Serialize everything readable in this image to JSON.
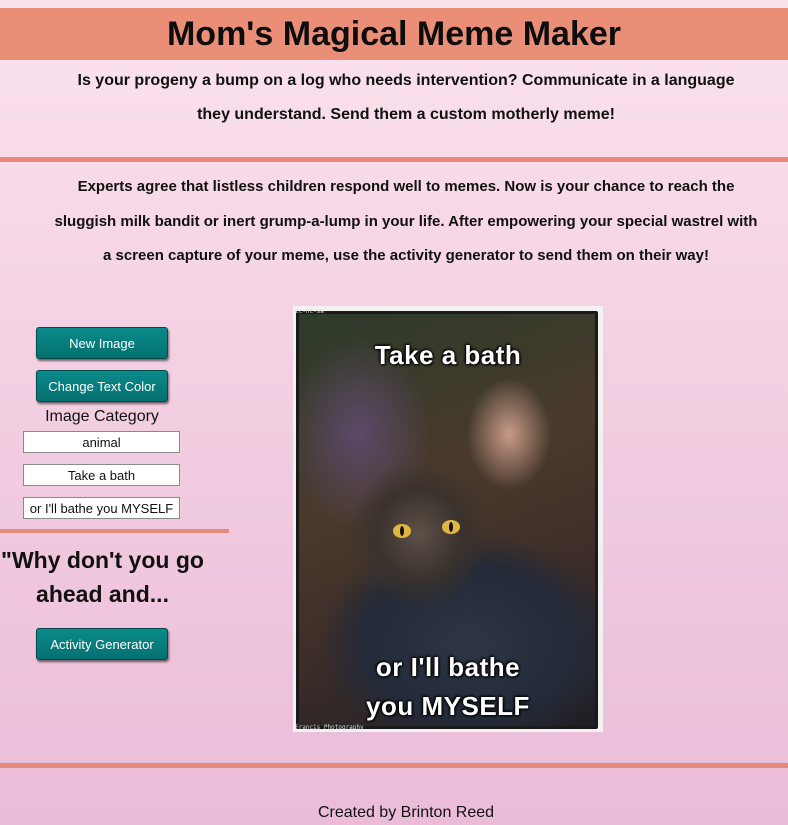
{
  "header": {
    "title": "Mom's Magical Meme Maker",
    "intro_line1": "Is your progeny a bump on a log who needs intervention? Communicate in a language",
    "intro_line2": "they understand. Send them a custom motherly meme!"
  },
  "description": {
    "line1": "Experts agree that listless children respond well to memes. Now is your chance to reach the",
    "line2": "sluggish milk bandit or inert grump-a-lump in your life. After empowering your special wastrel with",
    "line3": "a screen capture of your meme, use the activity generator to send them on their way!"
  },
  "controls": {
    "new_image_label": "New Image",
    "change_color_label": "Change Text Color",
    "category_label": "Image Category",
    "category_value": "animal",
    "top_text_value": "Take a bath",
    "bottom_text_value": "or I'll bathe you MYSELF"
  },
  "activity": {
    "prompt_line1": "\"Why don't you go",
    "prompt_line2": "ahead and...",
    "button_label": "Activity Generator"
  },
  "meme": {
    "top_text": "Take a bath",
    "bottom_line1": "or I'll bathe",
    "bottom_line2": "you MYSELF",
    "watermark_top": "cc-nc-sa",
    "watermark_bottom": "Francis Photography",
    "text_color": "#ffffff"
  },
  "footer": {
    "line1": "Created by Brinton Reed"
  },
  "colors": {
    "header_bar": "#eb8e77",
    "rule": "#e4897b",
    "button": "#0a8a8a",
    "background_top": "#fbe3ee",
    "background_bottom": "#ebbcd8"
  }
}
